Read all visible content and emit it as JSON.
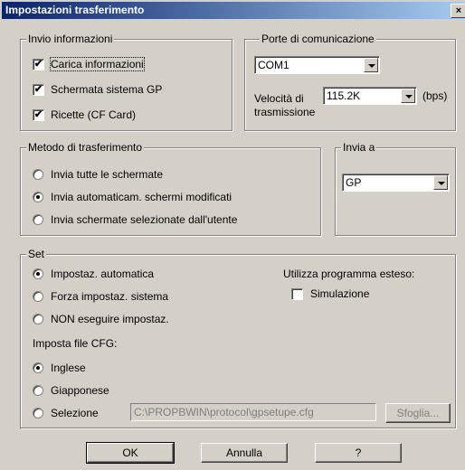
{
  "dialog": {
    "title": "Impostazioni trasferimento",
    "close_label": "×"
  },
  "invio": {
    "legend": "Invio informazioni",
    "items": [
      {
        "label": "Carica informazioni",
        "checked": true
      },
      {
        "label": "Schermata sistema GP",
        "checked": true
      },
      {
        "label": "Ricette (CF Card)",
        "checked": true
      }
    ]
  },
  "porte": {
    "legend": "Porte di comunicazione",
    "port_value": "COM1",
    "speed_label_1": "Velocità di",
    "speed_label_2": "trasmissione",
    "speed_value": "115.2K",
    "speed_unit": "(bps)"
  },
  "metodo": {
    "legend": "Metodo di trasferimento",
    "options": [
      {
        "label": "Invia tutte le schermate",
        "selected": false
      },
      {
        "label": "Invia automaticam. schermi modificati",
        "selected": true
      },
      {
        "label": "Invia schermate selezionate dall'utente",
        "selected": false
      }
    ]
  },
  "invia_a": {
    "legend": "Invia a",
    "value": "GP"
  },
  "set": {
    "legend": "Set",
    "options": [
      {
        "label": "Impostaz. automatica",
        "selected": true
      },
      {
        "label": "Forza impostaz. sistema",
        "selected": false
      },
      {
        "label": "NON eseguire impostaz.",
        "selected": false
      }
    ],
    "ext_label": "Utilizza programma esteso:",
    "simulazione_label": "Simulazione",
    "simulazione_checked": false,
    "cfg_label": "Imposta file CFG:",
    "cfg_options": [
      {
        "label": "Inglese",
        "selected": true
      },
      {
        "label": "Giapponese",
        "selected": false
      },
      {
        "label": "Selezione",
        "selected": false
      }
    ],
    "path_value": "C:\\PROPBWIN\\protocol\\gpsetupe.cfg",
    "browse_label": "Sfoglia..."
  },
  "buttons": {
    "ok": "OK",
    "cancel": "Annulla",
    "help": "?"
  }
}
